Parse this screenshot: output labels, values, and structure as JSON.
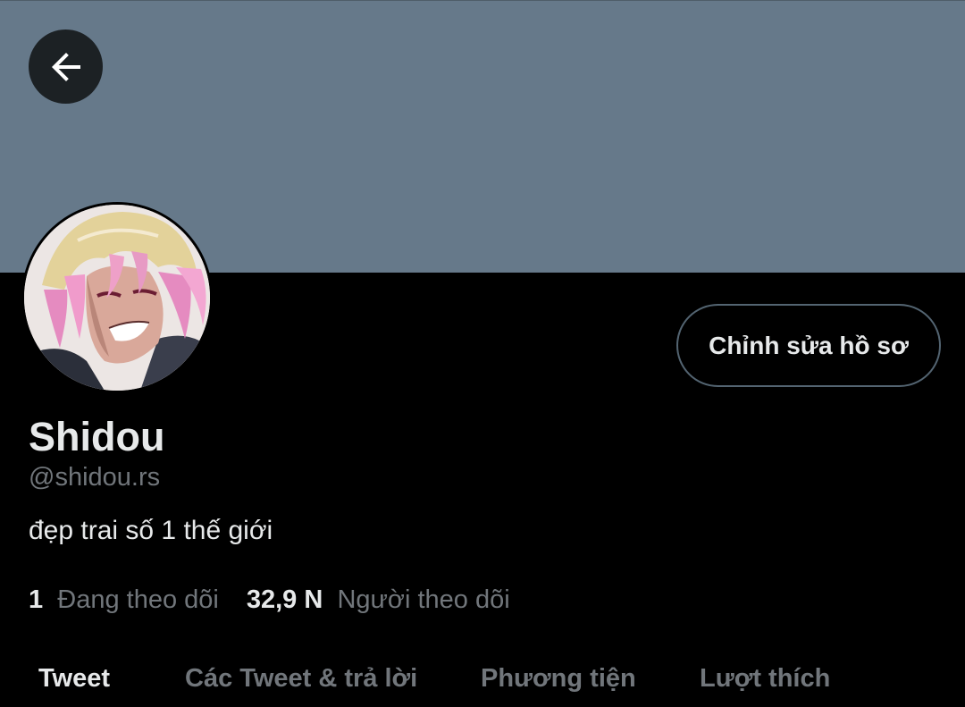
{
  "header": {
    "back_icon": "arrow-left-icon",
    "banner_color": "#66798a"
  },
  "profile": {
    "display_name": "Shidou",
    "handle": "@shidou.rs",
    "bio": "đẹp trai số 1 thế giới",
    "edit_button_label": "Chỉnh sửa hồ sơ",
    "following_count": "1",
    "following_label": "Đang theo dõi",
    "followers_count": "32,9 N",
    "followers_label": "Người theo dõi"
  },
  "tabs": [
    {
      "label": "Tweet",
      "active": true
    },
    {
      "label": "Các Tweet & trả lời",
      "active": false
    },
    {
      "label": "Phương tiện",
      "active": false
    },
    {
      "label": "Lượt thích",
      "active": false
    }
  ],
  "colors": {
    "background": "#000000",
    "primary_text": "#e7e9ea",
    "secondary_text": "#71767b",
    "button_border": "#536471"
  }
}
